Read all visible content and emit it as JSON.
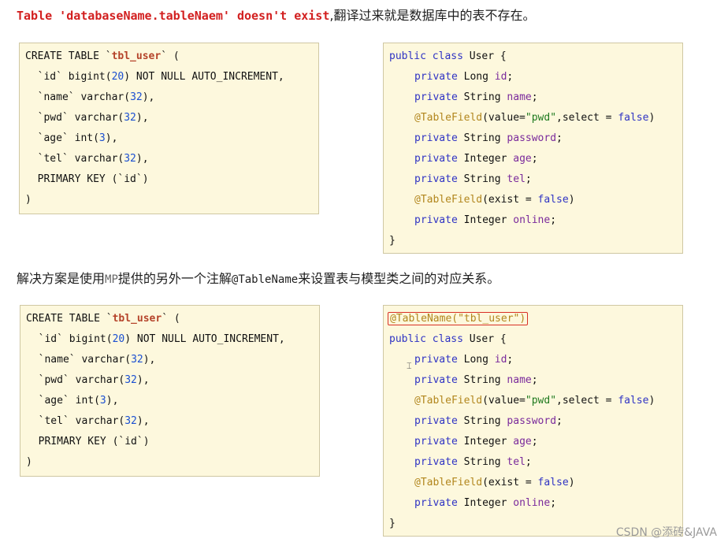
{
  "intro": {
    "error_text": "Table 'databaseName.tableNaem' doesn't exist",
    "explanation": ",翻译过来就是数据库中的表不存在。"
  },
  "solution": {
    "prefix": "解决方案是使用",
    "mp": "MP",
    "middle": "提供的另外一个注解",
    "annotation": "@TableName",
    "suffix": "来设置表与模型类之间的对应关系。"
  },
  "sql": {
    "create": "CREATE TABLE `",
    "table_name": "tbl_user",
    "create_end": "` (",
    "id_col": "  `id` bigint(",
    "id_len": "20",
    "id_rest": ") NOT NULL AUTO_INCREMENT,",
    "name_col": "  `name` varchar(",
    "name_len": "32",
    "name_end": "),",
    "pwd_col": "  `pwd` varchar(",
    "pwd_len": "32",
    "pwd_end": "),",
    "age_col": "  `age` int(",
    "age_len": "3",
    "age_end": "),",
    "tel_col": "  `tel` varchar(",
    "tel_len": "32",
    "tel_end": "),",
    "pk": "  PRIMARY KEY (`id`)",
    "close": ")"
  },
  "java": {
    "public": "public",
    "class": "class",
    "class_name": " User {",
    "private": "private",
    "long": " Long ",
    "id": "id",
    "string": " String ",
    "name": "name",
    "annotation_field": "@TableField",
    "field_open": "(value=",
    "pwd_str": "\"pwd\"",
    "select_part": ",select = ",
    "false": "false",
    "close_paren": ")",
    "password": "password",
    "integer": " Integer ",
    "age": "age",
    "tel": "tel",
    "exist_part": "(exist = ",
    "online": "online",
    "semicolon": ";",
    "close_brace": "}",
    "table_name_annotation": "@TableName(\"tbl_user\")"
  },
  "watermark": "CSDN @添砖&JAVA"
}
